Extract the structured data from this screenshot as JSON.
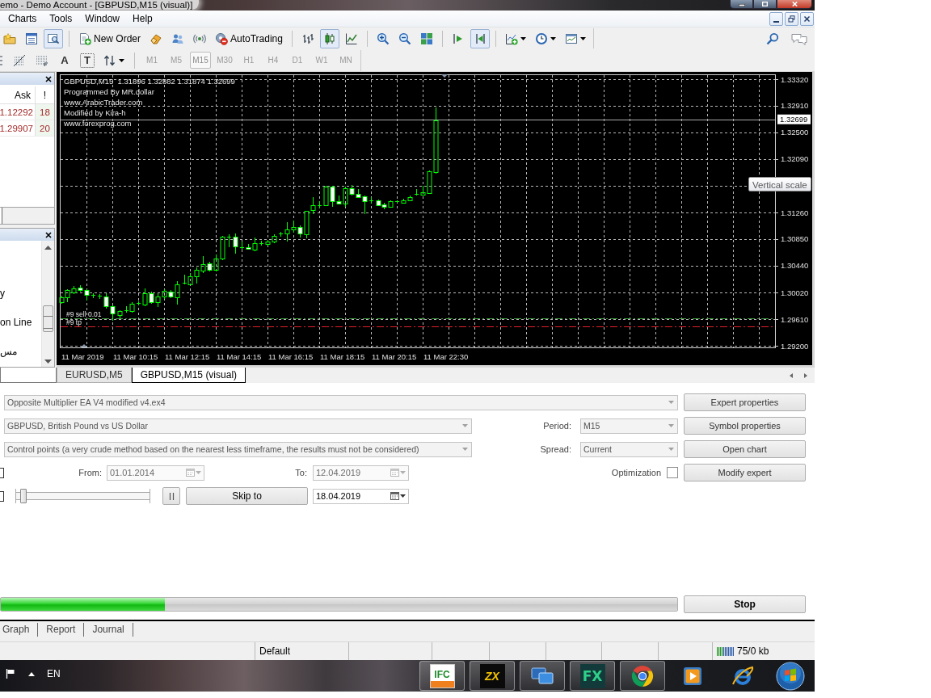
{
  "window": {
    "title": "emo - Demo Account - [GBPUSD,M15 (visual)]"
  },
  "menu": [
    {
      "label": "Charts"
    },
    {
      "label": "Tools"
    },
    {
      "label": "Window"
    },
    {
      "label": "Help"
    }
  ],
  "toolbar": {
    "items": [
      {
        "kind": "favorites",
        "pressed": false
      },
      {
        "kind": "market-watch",
        "pressed": false
      },
      {
        "kind": "navigator",
        "pressed": true
      },
      {
        "kind": "separator"
      },
      {
        "kind": "new-order",
        "label": "New Order",
        "pressed": false
      },
      {
        "kind": "eraser",
        "pressed": false
      },
      {
        "kind": "terminal",
        "pressed": false
      },
      {
        "kind": "signals",
        "pressed": false
      },
      {
        "kind": "autotrading",
        "label": "AutoTrading",
        "pressed": false
      },
      {
        "kind": "separator"
      },
      {
        "kind": "bar-chart",
        "pressed": false
      },
      {
        "kind": "candles",
        "pressed": true
      },
      {
        "kind": "line-chart",
        "pressed": false
      },
      {
        "kind": "separator"
      },
      {
        "kind": "zoom-in",
        "pressed": false
      },
      {
        "kind": "zoom-out",
        "pressed": false
      },
      {
        "kind": "tile",
        "pressed": false
      },
      {
        "kind": "separator"
      },
      {
        "kind": "chart-shift",
        "pressed": false
      },
      {
        "kind": "autoscroll",
        "pressed": true
      },
      {
        "kind": "separator"
      },
      {
        "kind": "indicators",
        "pressed": false,
        "dropdown": true
      },
      {
        "kind": "periods",
        "pressed": false,
        "dropdown": true
      },
      {
        "kind": "templates",
        "pressed": false,
        "dropdown": true
      }
    ],
    "right": [
      {
        "kind": "search"
      },
      {
        "kind": "chat"
      }
    ]
  },
  "toolbar2": {
    "tools": [
      {
        "kind": "cut-off"
      },
      {
        "kind": "fibo"
      },
      {
        "kind": "fibo-fan"
      },
      {
        "kind": "text",
        "glyph": "A"
      },
      {
        "kind": "label",
        "glyph": "T"
      },
      {
        "kind": "arrows",
        "dropdown": true
      }
    ],
    "timeframes": [
      {
        "label": "M1",
        "selected": false
      },
      {
        "label": "M5",
        "selected": false
      },
      {
        "label": "M15",
        "selected": true
      },
      {
        "label": "M30",
        "selected": false
      },
      {
        "label": "H1",
        "selected": false
      },
      {
        "label": "H4",
        "selected": false
      },
      {
        "label": "D1",
        "selected": false
      },
      {
        "label": "W1",
        "selected": false
      },
      {
        "label": "MN",
        "selected": false
      }
    ]
  },
  "market_watch": {
    "columns": [
      {
        "label": "Ask"
      },
      {
        "label": "!"
      }
    ],
    "rows": [
      {
        "ask": "1.12292",
        "spread": "18"
      },
      {
        "ask": "1.29907",
        "spread": "20"
      }
    ]
  },
  "navigator": {
    "items": [
      {
        "label": "y"
      },
      {
        "label": "on Line"
      },
      {
        "label": "مس"
      }
    ]
  },
  "chart": {
    "info": [
      "GBPUSD,M15  1.31896 1.32882 1.31874 1.32699",
      "Programmed By MR.dollar",
      "www.ArabicTrader.com",
      "Modified by Kira-h",
      "www.forexprog.com"
    ],
    "orders": [
      {
        "label": "#9 sell 0.01",
        "kind": "sell"
      },
      {
        "label": "#9 tp",
        "kind": "tp"
      }
    ],
    "price_labels": [
      "1.33320",
      "1.32910",
      "1.32500",
      "1.32090",
      "1.31260",
      "1.30850",
      "1.30440",
      "1.30020",
      "1.29610",
      "1.29200"
    ],
    "current_price": "1.32699",
    "time_labels": [
      "11 Mar 2019",
      "11 Mar 10:15",
      "11 Mar 12:15",
      "11 Mar 14:15",
      "11 Mar 16:15",
      "11 Mar 18:15",
      "11 Mar 20:15",
      "11 Mar 22:30"
    ],
    "tooltip": "Vertical scale"
  },
  "chart_tabs": [
    {
      "label": "EURUSD,M5",
      "selected": false
    },
    {
      "label": "GBPUSD,M15 (visual)",
      "selected": true
    }
  ],
  "tester": {
    "expert": {
      "value": "Opposite Multiplier EA V4 modified v4.ex4",
      "disabled": true
    },
    "symbol": {
      "value": "GBPUSD, British Pound vs US Dollar",
      "disabled": true
    },
    "model": {
      "value": "Control points (a very crude method based on the nearest less timeframe, the results must not be considered)",
      "disabled": true
    },
    "period": {
      "label": "Period:",
      "value": "M15",
      "disabled": true
    },
    "spread": {
      "label": "Spread:",
      "value": "Current",
      "disabled": true
    },
    "date_checkbox": {
      "checked": false
    },
    "from": {
      "label": "From:",
      "value": "01.01.2014",
      "disabled": true
    },
    "to": {
      "label": "To:",
      "value": "12.04.2019",
      "disabled": true
    },
    "optimization": {
      "label": "Optimization",
      "checked": false
    },
    "slider_checkbox": {
      "checked": false
    },
    "speed": {
      "level": 0.02
    },
    "skip_to": {
      "label": "Skip to",
      "date": "18.04.2019",
      "disabled": false
    },
    "buttons": [
      {
        "label": "Expert properties"
      },
      {
        "label": "Symbol properties"
      },
      {
        "label": "Open chart"
      },
      {
        "label": "Modify expert"
      }
    ],
    "progress": {
      "level": 0.243
    },
    "stop": {
      "label": "Stop"
    }
  },
  "bottom_tabs": [
    {
      "label": "Graph",
      "selected": false
    },
    {
      "label": "Report",
      "selected": false
    },
    {
      "label": "Journal",
      "selected": false
    }
  ],
  "status_bar": {
    "profile": "Default",
    "traffic": "75/0 kb"
  },
  "taskbar": {
    "language": "EN",
    "apps": [
      {
        "kind": "ifc",
        "logo": "IFC",
        "running": true
      },
      {
        "kind": "zx",
        "logo": "ZX",
        "running": true
      },
      {
        "kind": "windows",
        "running": true
      },
      {
        "kind": "fx",
        "logo": "FX",
        "running": true
      },
      {
        "kind": "chrome",
        "running": true
      },
      {
        "kind": "media",
        "running": false
      },
      {
        "kind": "ie",
        "running": false
      }
    ]
  }
}
